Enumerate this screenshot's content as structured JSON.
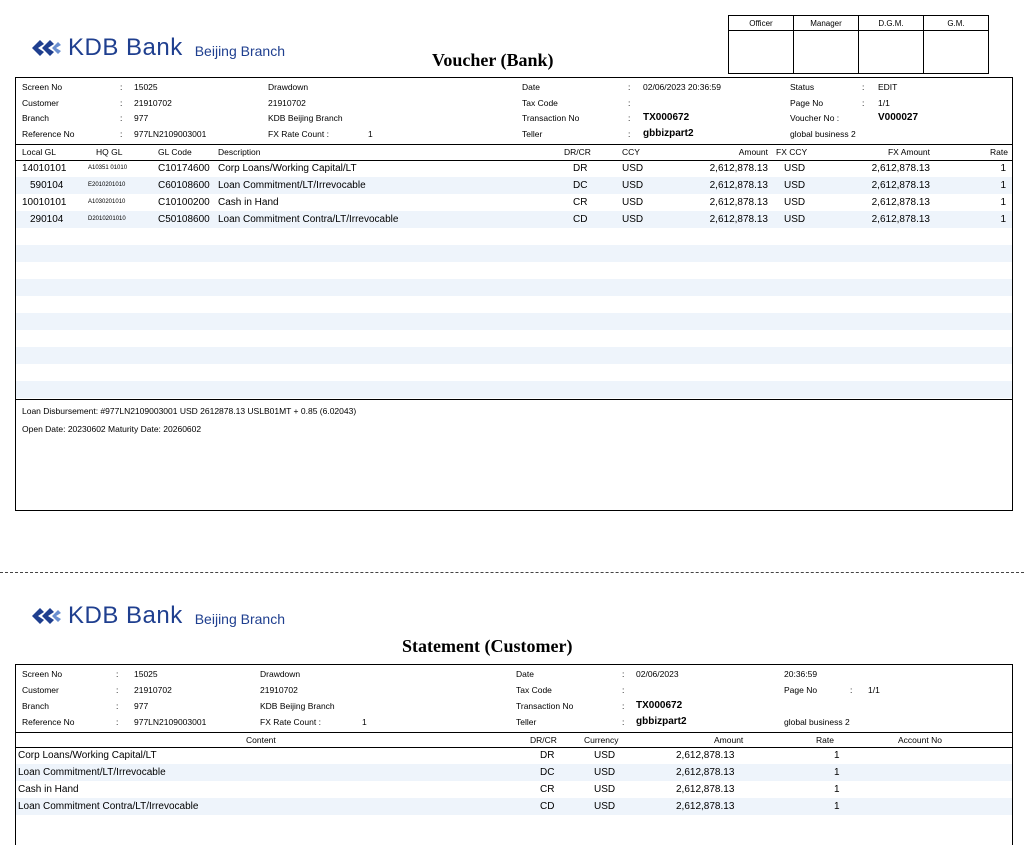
{
  "bank": {
    "name": "KDB Bank",
    "branch": "Beijing Branch"
  },
  "voucher": {
    "title": "Voucher (Bank)",
    "signoff": [
      "Officer",
      "Manager",
      "D.G.M.",
      "G.M."
    ],
    "info": {
      "screen_no_label": "Screen No",
      "screen_no": "15025",
      "screen_name": "Drawdown",
      "customer_label": "Customer",
      "customer": "21910702",
      "customer_name": "21910702",
      "branch_label": "Branch",
      "branch": "977",
      "branch_name": "KDB Beijing Branch",
      "ref_label": "Reference No",
      "ref": "977LN2109003001",
      "fx_label": "FX Rate Count :",
      "fx": "1",
      "date_label": "Date",
      "date": "02/06/2023  20:36:59",
      "tax_label": "Tax Code",
      "tax": "",
      "txn_label": "Transaction No",
      "txn": "TX000672",
      "teller_label": "Teller",
      "teller": "gbbizpart2",
      "status_label": "Status",
      "status": "EDIT",
      "page_label": "Page No",
      "page": "1/1",
      "voucher_label": "Voucher No :",
      "voucher": "V000027",
      "teller_group": "global business 2",
      "colon": ":"
    },
    "columns": [
      "Local GL",
      "HQ GL",
      "GL Code",
      "Description",
      "DR/CR",
      "CCY",
      "Amount",
      "FX CCY",
      "FX Amount",
      "Rate"
    ],
    "rows": [
      {
        "local": "14010101",
        "hq": "A10351 01010",
        "gl": "C10174600",
        "desc": "Corp Loans/Working Capital/LT",
        "drcr": "DR",
        "ccy": "USD",
        "amount": "2,612,878.13",
        "fxccy": "USD",
        "fxamount": "2,612,878.13",
        "rate": "1"
      },
      {
        "local": "590104",
        "hq": "E2010201010",
        "gl": "C60108600",
        "desc": "Loan Commitment/LT/Irrevocable",
        "drcr": "DC",
        "ccy": "USD",
        "amount": "2,612,878.13",
        "fxccy": "USD",
        "fxamount": "2,612,878.13",
        "rate": "1"
      },
      {
        "local": "10010101",
        "hq": "A1030201010",
        "gl": "C10100200",
        "desc": "Cash in Hand",
        "drcr": "CR",
        "ccy": "USD",
        "amount": "2,612,878.13",
        "fxccy": "USD",
        "fxamount": "2,612,878.13",
        "rate": "1"
      },
      {
        "local": "290104",
        "hq": "D2010201010",
        "gl": "C50108600",
        "desc": "Loan Commitment Contra/LT/Irrevocable",
        "drcr": "CD",
        "ccy": "USD",
        "amount": "2,612,878.13",
        "fxccy": "USD",
        "fxamount": "2,612,878.13",
        "rate": "1"
      }
    ],
    "note1": "Loan Disbursement: #977LN2109003001 USD 2612878.13 USLB01MT + 0.85 (6.02043)",
    "note2": "Open Date: 20230602 Maturity Date: 20260602"
  },
  "statement": {
    "title": "Statement (Customer)",
    "info": {
      "screen_no_label": "Screen No",
      "screen_no": "15025",
      "screen_name": "Drawdown",
      "customer_label": "Customer",
      "customer": "21910702",
      "customer_name": "21910702",
      "branch_label": "Branch",
      "branch": "977",
      "branch_name": "KDB Beijing Branch",
      "ref_label": "Reference No",
      "ref": "977LN2109003001",
      "fx_label": "FX Rate Count :",
      "fx": "1",
      "date_label": "Date",
      "date": "02/06/2023",
      "time": "20:36:59",
      "tax_label": "Tax Code",
      "tax": "",
      "txn_label": "Transaction No",
      "txn": "TX000672",
      "teller_label": "Teller",
      "teller": "gbbizpart2",
      "page_label": "Page No",
      "page": "1/1",
      "teller_group": "global business 2",
      "colon": ":"
    },
    "columns": [
      "Content",
      "DR/CR",
      "Currency",
      "Amount",
      "Rate",
      "Account No"
    ],
    "rows": [
      {
        "content": "Corp Loans/Working Capital/LT",
        "drcr": "DR",
        "ccy": "USD",
        "amount": "2,612,878.13",
        "rate": "1",
        "account": ""
      },
      {
        "content": "Loan Commitment/LT/Irrevocable",
        "drcr": "DC",
        "ccy": "USD",
        "amount": "2,612,878.13",
        "rate": "1",
        "account": ""
      },
      {
        "content": "Cash in Hand",
        "drcr": "CR",
        "ccy": "USD",
        "amount": "2,612,878.13",
        "rate": "1",
        "account": ""
      },
      {
        "content": "Loan Commitment Contra/LT/Irrevocable",
        "drcr": "CD",
        "ccy": "USD",
        "amount": "2,612,878.13",
        "rate": "1",
        "account": ""
      }
    ]
  }
}
